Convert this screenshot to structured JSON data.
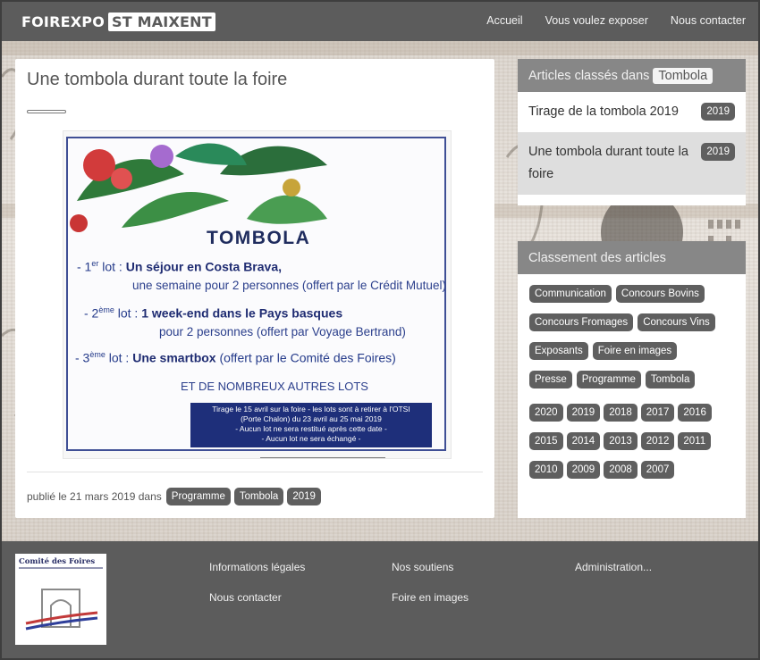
{
  "header": {
    "logo_part1": "FOIREXPO",
    "logo_part2": "ST MAIXENT",
    "nav": [
      "Accueil",
      "Vous voulez exposer",
      "Nous contacter"
    ]
  },
  "article": {
    "title": "Une tombola durant toute la foire",
    "published_text": "publié le 21 mars 2019 dans",
    "tags": [
      "Programme",
      "Tombola",
      "2019"
    ],
    "poster": {
      "title": "TOMBOLA",
      "lot1_prefix": "- 1",
      "lot1_sup": "er",
      "lot1_label": " lot : ",
      "lot1_main": "Un séjour en Costa Brava,",
      "lot1_sub": "une semaine pour 2 personnes (offert par le Crédit Mutuel)",
      "lot2_prefix": "- 2",
      "lot2_sup": "ème",
      "lot2_label": " lot : ",
      "lot2_main": "1 week-end dans le Pays basques",
      "lot2_sub": "pour 2 personnes (offert par Voyage Bertrand)",
      "lot3_prefix": "- 3",
      "lot3_sup": "ème",
      "lot3_label": " lot : ",
      "lot3_main": "Une smartbox",
      "lot3_rest": " (offert par le Comité des Foires)",
      "more": "ET DE NOMBREUX AUTRES LOTS",
      "box_line1": "Tirage le 15 avril sur la foire  -  les lots sont à retirer à l'OTSI",
      "box_line2": "(Porte Chalon) du 23 avril au 25 mai 2019",
      "box_line3": "- Aucun lot ne sera restitué après cette date -",
      "box_line4": "- Aucun lot ne sera échangé -"
    }
  },
  "sidebar": {
    "classified_prefix": "Articles classés dans",
    "classified_tag": "Tombola",
    "articles": [
      {
        "title": "Tirage de la tombola 2019",
        "year": "2019"
      },
      {
        "title": "Une tombola durant toute la foire",
        "year": "2019"
      }
    ],
    "ranking_title": "Classement des articles",
    "categories": [
      "Communication",
      "Concours Bovins",
      "Concours Fromages",
      "Concours Vins",
      "Exposants",
      "Foire en images",
      "Presse",
      "Programme",
      "Tombola"
    ],
    "years": [
      "2020",
      "2019",
      "2018",
      "2017",
      "2016",
      "2015",
      "2014",
      "2013",
      "2012",
      "2011",
      "2010",
      "2009",
      "2008",
      "2007"
    ]
  },
  "footer": {
    "logo_text": "Comité des Foires",
    "col1": [
      "Informations légales",
      "Nous contacter"
    ],
    "col2": [
      "Nos soutiens",
      "Foire en images"
    ],
    "col3": [
      "Administration..."
    ]
  },
  "colors": {
    "header_bg": "#5c5c5c",
    "tag_bg": "#5f5f5f",
    "poster_blue": "#1e2f7a"
  }
}
